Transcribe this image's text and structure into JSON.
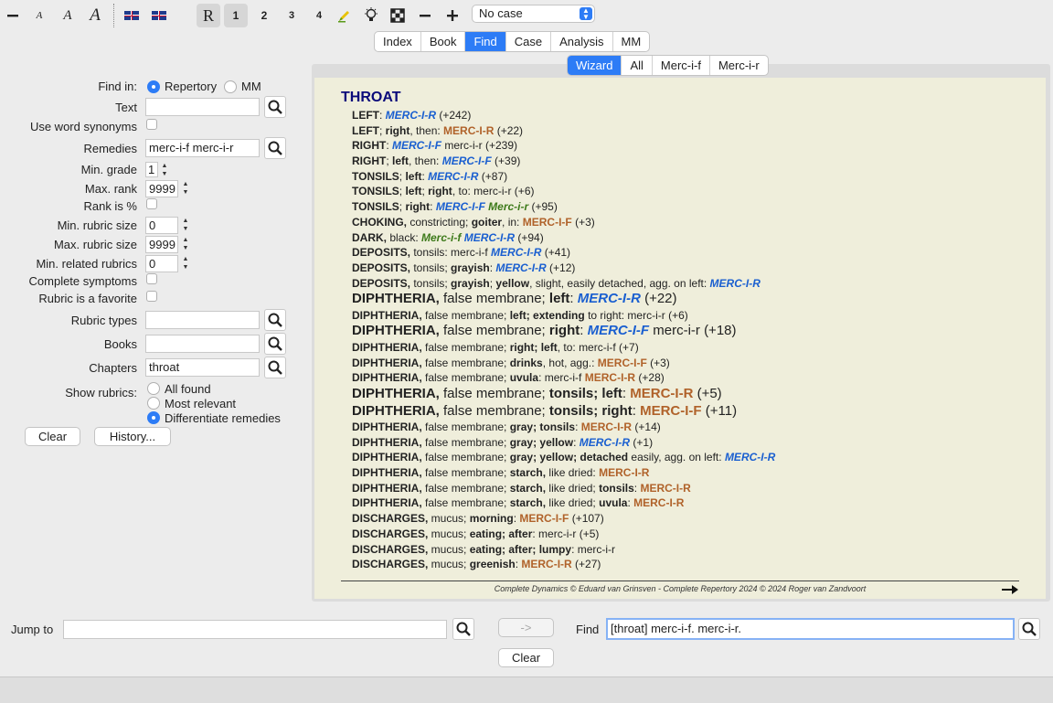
{
  "toolbar": {
    "font_small": "A",
    "font_medium": "A",
    "font_large": "A",
    "mode_r": "R",
    "grade_1": "1",
    "grade_2": "2",
    "grade_3": "3",
    "grade_4": "4",
    "case_select": "No case"
  },
  "nav_tabs": [
    "Index",
    "Book",
    "Find",
    "Case",
    "Analysis",
    "MM"
  ],
  "result_tabs": [
    "Wizard",
    "All",
    "Merc-i-f",
    "Merc-i-r"
  ],
  "form": {
    "find_in_label": "Find in:",
    "find_in_options": [
      "Repertory",
      "MM"
    ],
    "text_label": "Text",
    "text_value": "",
    "synonyms_label": "Use word synonyms",
    "remedies_label": "Remedies",
    "remedies_value": "merc-i-f merc-i-r",
    "min_grade_label": "Min. grade",
    "min_grade_value": "1",
    "max_rank_label": "Max. rank",
    "max_rank_value": "9999",
    "rank_pct_label": "Rank is %",
    "min_rubric_label": "Min. rubric size",
    "min_rubric_value": "0",
    "max_rubric_label": "Max. rubric size",
    "max_rubric_value": "9999",
    "min_related_label": "Min. related rubrics",
    "min_related_value": "0",
    "complete_label": "Complete symptoms",
    "favorite_label": "Rubric is a favorite",
    "types_label": "Rubric types",
    "types_value": "",
    "books_label": "Books",
    "books_value": "",
    "chapters_label": "Chapters",
    "chapters_value": "throat",
    "show_label": "Show rubrics:",
    "show_options": [
      "All found",
      "Most relevant",
      "Differentiate remedies"
    ],
    "clear_button": "Clear",
    "history_button": "History..."
  },
  "results": {
    "chapter": "THROAT",
    "rubrics": [
      {
        "size": "n",
        "parts": [
          [
            "b",
            "LEFT"
          ],
          [
            "t",
            ": "
          ],
          [
            "bl",
            "MERC-I-R"
          ],
          [
            "t",
            " (+242)"
          ]
        ]
      },
      {
        "size": "n",
        "parts": [
          [
            "b",
            "LEFT"
          ],
          [
            "t",
            "; "
          ],
          [
            "b",
            "right"
          ],
          [
            "t",
            ", then: "
          ],
          [
            "br",
            "MERC-I-R"
          ],
          [
            "t",
            " (+22)"
          ]
        ]
      },
      {
        "size": "n",
        "parts": [
          [
            "b",
            "RIGHT"
          ],
          [
            "t",
            ": "
          ],
          [
            "bl",
            "MERC-I-F"
          ],
          [
            "t",
            " merc-i-r (+239)"
          ]
        ]
      },
      {
        "size": "n",
        "parts": [
          [
            "b",
            "RIGHT"
          ],
          [
            "t",
            "; "
          ],
          [
            "b",
            "left"
          ],
          [
            "t",
            ", then: "
          ],
          [
            "bl",
            "MERC-I-F"
          ],
          [
            "t",
            " (+39)"
          ]
        ]
      },
      {
        "size": "n",
        "parts": [
          [
            "b",
            "TONSILS"
          ],
          [
            "t",
            "; "
          ],
          [
            "b",
            "left"
          ],
          [
            "t",
            ": "
          ],
          [
            "bl",
            "MERC-I-R"
          ],
          [
            "t",
            " (+87)"
          ]
        ]
      },
      {
        "size": "n",
        "parts": [
          [
            "b",
            "TONSILS"
          ],
          [
            "t",
            "; "
          ],
          [
            "b",
            "left"
          ],
          [
            "t",
            "; "
          ],
          [
            "b",
            "right"
          ],
          [
            "t",
            ", to: merc-i-r (+6)"
          ]
        ]
      },
      {
        "size": "n",
        "parts": [
          [
            "b",
            "TONSILS"
          ],
          [
            "t",
            "; "
          ],
          [
            "b",
            "right"
          ],
          [
            "t",
            ": "
          ],
          [
            "bl",
            "MERC-I-F"
          ],
          [
            "t",
            " "
          ],
          [
            "gr",
            "Merc-i-r"
          ],
          [
            "t",
            " (+95)"
          ]
        ]
      },
      {
        "size": "n",
        "parts": [
          [
            "b",
            "CHOKING,"
          ],
          [
            "t",
            " constricting; "
          ],
          [
            "b",
            "goiter"
          ],
          [
            "t",
            ", in: "
          ],
          [
            "br",
            "MERC-I-F"
          ],
          [
            "t",
            " (+3)"
          ]
        ]
      },
      {
        "size": "n",
        "parts": [
          [
            "b",
            "DARK,"
          ],
          [
            "t",
            " black: "
          ],
          [
            "gr",
            "Merc-i-f"
          ],
          [
            "t",
            " "
          ],
          [
            "bl",
            "MERC-I-R"
          ],
          [
            "t",
            " (+94)"
          ]
        ]
      },
      {
        "size": "n",
        "parts": [
          [
            "b",
            "DEPOSITS,"
          ],
          [
            "t",
            " tonsils: merc-i-f "
          ],
          [
            "bl",
            "MERC-I-R"
          ],
          [
            "t",
            " (+41)"
          ]
        ]
      },
      {
        "size": "n",
        "parts": [
          [
            "b",
            "DEPOSITS,"
          ],
          [
            "t",
            " tonsils; "
          ],
          [
            "b",
            "grayish"
          ],
          [
            "t",
            ": "
          ],
          [
            "bl",
            "MERC-I-R"
          ],
          [
            "t",
            " (+12)"
          ]
        ]
      },
      {
        "size": "n",
        "parts": [
          [
            "b",
            "DEPOSITS,"
          ],
          [
            "t",
            " tonsils; "
          ],
          [
            "b",
            "grayish"
          ],
          [
            "t",
            "; "
          ],
          [
            "b",
            "yellow"
          ],
          [
            "t",
            ", slight, easily detached, agg. on left: "
          ],
          [
            "bl",
            "MERC-I-R"
          ]
        ]
      },
      {
        "size": "big",
        "parts": [
          [
            "b",
            "DIPHTHERIA,"
          ],
          [
            "t",
            " false membrane; "
          ],
          [
            "b",
            "left"
          ],
          [
            "t",
            ": "
          ],
          [
            "bl",
            "MERC-I-R"
          ],
          [
            "t",
            " (+22)"
          ]
        ]
      },
      {
        "size": "n",
        "parts": [
          [
            "b",
            "DIPHTHERIA,"
          ],
          [
            "t",
            " false membrane; "
          ],
          [
            "b",
            "left; extending"
          ],
          [
            "t",
            " to right: merc-i-r (+6)"
          ]
        ]
      },
      {
        "size": "big",
        "parts": [
          [
            "b",
            "DIPHTHERIA,"
          ],
          [
            "t",
            " false membrane; "
          ],
          [
            "b",
            "right"
          ],
          [
            "t",
            ": "
          ],
          [
            "bl",
            "MERC-I-F"
          ],
          [
            "t",
            " merc-i-r (+18)"
          ]
        ]
      },
      {
        "size": "n",
        "parts": [
          [
            "b",
            "DIPHTHERIA,"
          ],
          [
            "t",
            " false membrane; "
          ],
          [
            "b",
            "right; left"
          ],
          [
            "t",
            ", to: merc-i-f (+7)"
          ]
        ]
      },
      {
        "size": "n",
        "parts": [
          [
            "b",
            "DIPHTHERIA,"
          ],
          [
            "t",
            " false membrane; "
          ],
          [
            "b",
            "drinks"
          ],
          [
            "t",
            ", hot, agg.: "
          ],
          [
            "br",
            "MERC-I-F"
          ],
          [
            "t",
            " (+3)"
          ]
        ]
      },
      {
        "size": "n",
        "parts": [
          [
            "b",
            "DIPHTHERIA,"
          ],
          [
            "t",
            " false membrane; "
          ],
          [
            "b",
            "uvula"
          ],
          [
            "t",
            ": merc-i-f "
          ],
          [
            "br",
            "MERC-I-R"
          ],
          [
            "t",
            " (+28)"
          ]
        ]
      },
      {
        "size": "big",
        "parts": [
          [
            "b",
            "DIPHTHERIA,"
          ],
          [
            "t",
            " false membrane; "
          ],
          [
            "b",
            "tonsils; left"
          ],
          [
            "t",
            ": "
          ],
          [
            "br",
            "MERC-I-R"
          ],
          [
            "t",
            " (+5)"
          ]
        ]
      },
      {
        "size": "big",
        "parts": [
          [
            "b",
            "DIPHTHERIA,"
          ],
          [
            "t",
            " false membrane; "
          ],
          [
            "b",
            "tonsils; right"
          ],
          [
            "t",
            ": "
          ],
          [
            "br",
            "MERC-I-F"
          ],
          [
            "t",
            " (+11)"
          ]
        ]
      },
      {
        "size": "n",
        "parts": [
          [
            "b",
            "DIPHTHERIA,"
          ],
          [
            "t",
            " false membrane; "
          ],
          [
            "b",
            "gray; tonsils"
          ],
          [
            "t",
            ": "
          ],
          [
            "br",
            "MERC-I-R"
          ],
          [
            "t",
            " (+14)"
          ]
        ]
      },
      {
        "size": "n",
        "parts": [
          [
            "b",
            "DIPHTHERIA,"
          ],
          [
            "t",
            " false membrane; "
          ],
          [
            "b",
            "gray; yellow"
          ],
          [
            "t",
            ": "
          ],
          [
            "bl",
            "MERC-I-R"
          ],
          [
            "t",
            " (+1)"
          ]
        ]
      },
      {
        "size": "n",
        "parts": [
          [
            "b",
            "DIPHTHERIA,"
          ],
          [
            "t",
            " false membrane; "
          ],
          [
            "b",
            "gray; yellow; detached"
          ],
          [
            "t",
            " easily, agg. on left: "
          ],
          [
            "bl",
            "MERC-I-R"
          ]
        ]
      },
      {
        "size": "n",
        "parts": [
          [
            "b",
            "DIPHTHERIA,"
          ],
          [
            "t",
            " false membrane; "
          ],
          [
            "b",
            "starch,"
          ],
          [
            "t",
            " like dried: "
          ],
          [
            "br",
            "MERC-I-R"
          ]
        ]
      },
      {
        "size": "n",
        "parts": [
          [
            "b",
            "DIPHTHERIA,"
          ],
          [
            "t",
            " false membrane; "
          ],
          [
            "b",
            "starch,"
          ],
          [
            "t",
            " like dried; "
          ],
          [
            "b",
            "tonsils"
          ],
          [
            "t",
            ": "
          ],
          [
            "br",
            "MERC-I-R"
          ]
        ]
      },
      {
        "size": "n",
        "parts": [
          [
            "b",
            "DIPHTHERIA,"
          ],
          [
            "t",
            " false membrane; "
          ],
          [
            "b",
            "starch,"
          ],
          [
            "t",
            " like dried; "
          ],
          [
            "b",
            "uvula"
          ],
          [
            "t",
            ": "
          ],
          [
            "br",
            "MERC-I-R"
          ]
        ]
      },
      {
        "size": "n",
        "parts": [
          [
            "b",
            "DISCHARGES,"
          ],
          [
            "t",
            " mucus; "
          ],
          [
            "b",
            "morning"
          ],
          [
            "t",
            ": "
          ],
          [
            "br",
            "MERC-I-F"
          ],
          [
            "t",
            " (+107)"
          ]
        ]
      },
      {
        "size": "n",
        "parts": [
          [
            "b",
            "DISCHARGES,"
          ],
          [
            "t",
            " mucus; "
          ],
          [
            "b",
            "eating; after"
          ],
          [
            "t",
            ": merc-i-r (+5)"
          ]
        ]
      },
      {
        "size": "n",
        "parts": [
          [
            "b",
            "DISCHARGES,"
          ],
          [
            "t",
            " mucus; "
          ],
          [
            "b",
            "eating; after; lumpy"
          ],
          [
            "t",
            ": merc-i-r"
          ]
        ]
      },
      {
        "size": "n",
        "parts": [
          [
            "b",
            "DISCHARGES,"
          ],
          [
            "t",
            " mucus; "
          ],
          [
            "b",
            "greenish"
          ],
          [
            "t",
            ": "
          ],
          [
            "br",
            "MERC-I-R"
          ],
          [
            "t",
            " (+27)"
          ]
        ]
      }
    ],
    "footer": "Complete Dynamics © Eduard van Grinsven  -  Complete Repertory 2024 © 2024 Roger van Zandvoort"
  },
  "bottom": {
    "jump_label": "Jump to",
    "jump_value": "",
    "go_button": "->",
    "find_label": "Find",
    "find_value": "[throat] merc-i-f. merc-i-r.",
    "clear_button": "Clear"
  }
}
